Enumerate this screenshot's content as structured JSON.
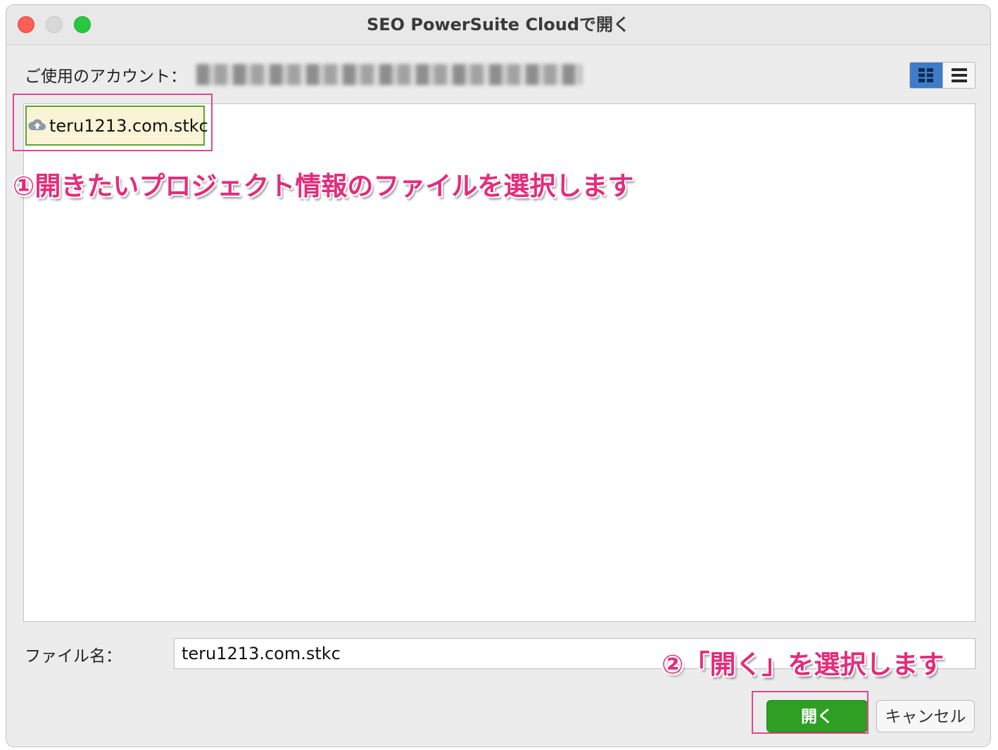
{
  "window": {
    "title": "SEO PowerSuite Cloudで開く"
  },
  "account": {
    "label": "ご使用のアカウント："
  },
  "view_toggle": {
    "selected": "grid"
  },
  "files": [
    {
      "name": "teru1213.com.stkc",
      "icon": "cloud-upload-icon"
    }
  ],
  "annotations": {
    "step1": "①開きたいプロジェクト情報のファイルを選択します",
    "step2": "②「開く」を選択します"
  },
  "filename": {
    "label": "ファイル名：",
    "value": "teru1213.com.stkc"
  },
  "buttons": {
    "open": "開く",
    "cancel": "キャンセル"
  },
  "colors": {
    "open_button": "#2e9f22",
    "annotation": "#e32d7c",
    "highlight_border": "#e0478f",
    "selected_item_bg": "#faf3d6",
    "selected_item_border": "#58a532",
    "view_toggle_active": "#3f7cc7"
  }
}
